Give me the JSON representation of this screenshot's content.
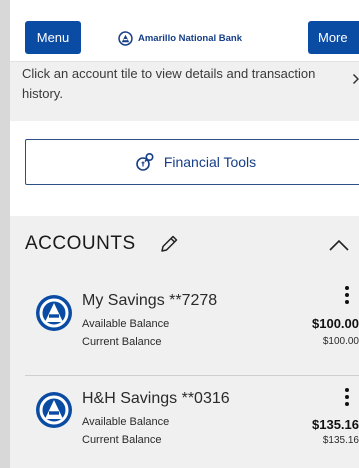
{
  "header": {
    "menu_label": "Menu",
    "more_label": "More",
    "brand_name": "Amarillo National Bank",
    "brand_color": "#153e86",
    "button_color": "#0a4ba4"
  },
  "banner": {
    "text": "Click an account tile to view details and transaction history.",
    "chevron_icon": "chevron-right-icon"
  },
  "tools": {
    "label": "Financial Tools",
    "icon": "financial-tools-icon"
  },
  "accounts": {
    "title": "ACCOUNTS",
    "edit_icon": "pencil-icon",
    "collapse_icon": "chevron-up-icon",
    "items": [
      {
        "name": "My Savings **7278",
        "available_label": "Available Balance",
        "current_label": "Current Balance",
        "available_balance": "$100.00",
        "current_balance": "$100.00"
      },
      {
        "name": "H&H Savings **0316",
        "available_label": "Available Balance",
        "current_label": "Current Balance",
        "available_balance": "$135.16",
        "current_balance": "$135.16"
      }
    ]
  }
}
